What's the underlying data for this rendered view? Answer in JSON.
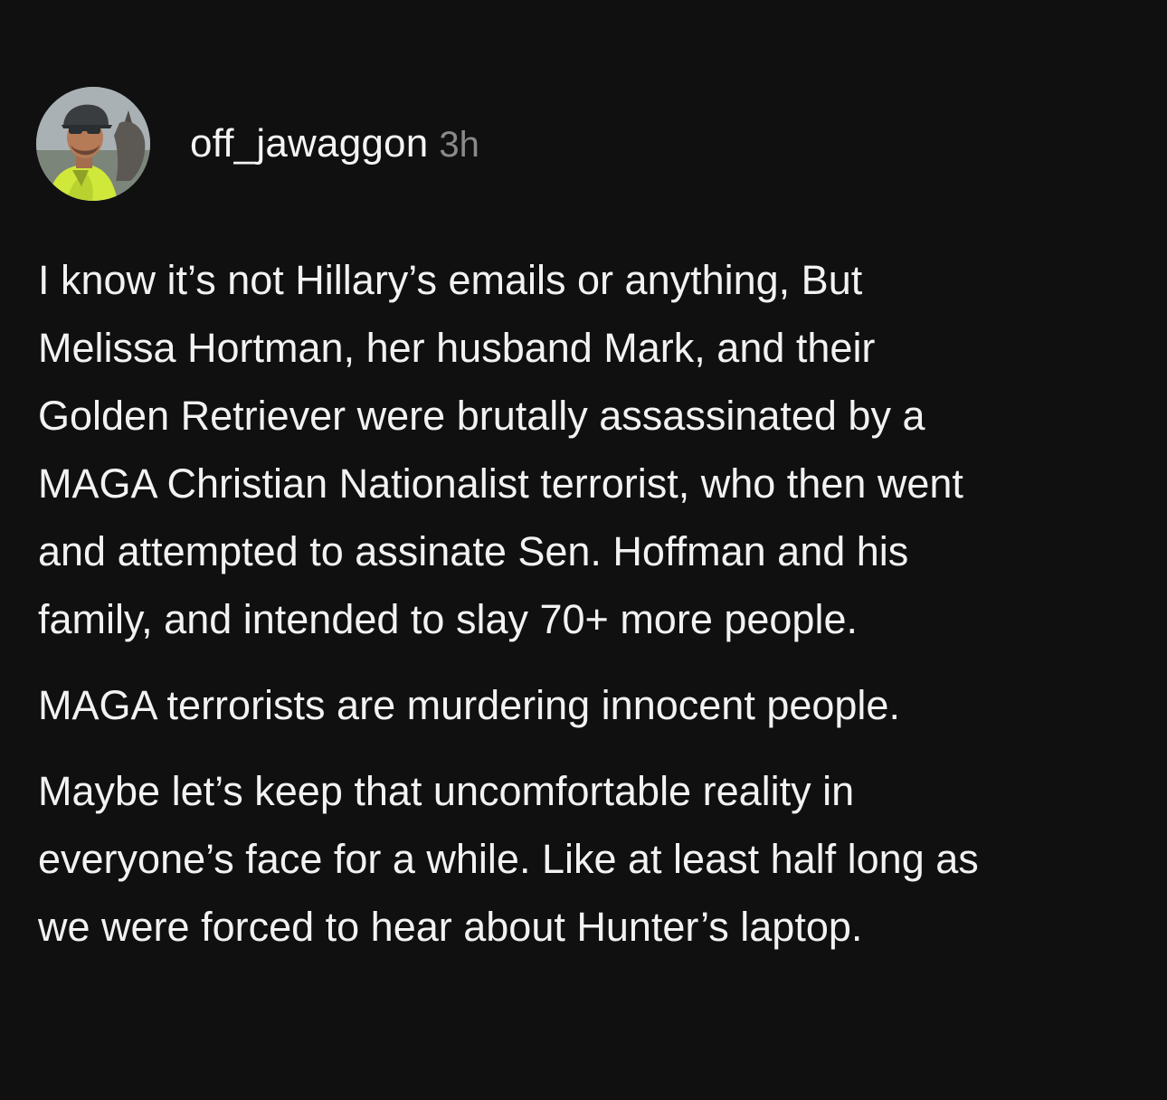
{
  "post": {
    "avatar_icon": "user-avatar-photo",
    "username": "off_jawaggon",
    "time": "3h",
    "paragraphs": [
      {
        "lines": [
          "I know it’s not Hillary’s emails or anything, But",
          "Melissa Hortman, her husband Mark, and their",
          "Golden Retriever were brutally assassinated by a",
          "MAGA Christian Nationalist terrorist, who then went",
          "and attempted to assinate Sen. Hoffman and his",
          "family, and intended to slay 70+ more people."
        ]
      },
      {
        "lines": [
          "MAGA terrorists are murdering innocent people."
        ]
      },
      {
        "lines": [
          "Maybe let’s keep that uncomfortable reality in",
          "everyone’s face for a while. Like at least half long as",
          "we were forced to hear about Hunter’s laptop."
        ]
      }
    ]
  },
  "colors": {
    "background": "#101010",
    "text": "#f2f2f2",
    "timestamp": "#8a8a8a"
  }
}
